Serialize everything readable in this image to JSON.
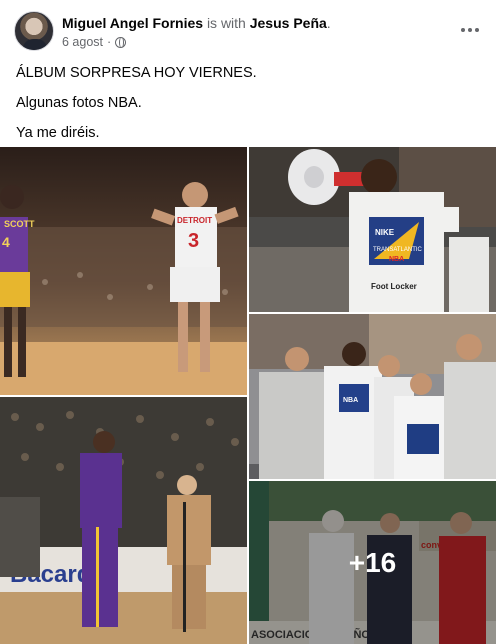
{
  "post": {
    "author": "Miguel Angel Fornies",
    "with_text": "is with",
    "tagged": "Jesus Peña",
    "tagged_suffix": ".",
    "date": "6 agost",
    "date_separator": "·",
    "privacy_icon": "globe-icon",
    "menu_icon": "more-dots-icon",
    "lines": [
      "ÁLBUM SORPRESA HOY VIERNES.",
      "Algunas fotos NBA.",
      "Ya me diréis."
    ]
  },
  "photos": {
    "tile1_jersey_left": "SCOTT",
    "tile1_number_left": "4",
    "tile1_jersey_main": "DETROIT",
    "tile1_number_main": "3",
    "tile2_shirt_brand": "NIKE",
    "tile2_shirt_line1": "TRANSATLANTIC",
    "tile2_shirt_line2": "NBA",
    "tile2_shirt_sponsor": "Foot Locker",
    "tile3_shirt_label": "NBA",
    "tile4_banner": "Bacardi",
    "tile5_wall_text": "ASOCIACION ESPAÑOLA",
    "tile5_corner_text": "conve",
    "more_count": "+16"
  },
  "colors": {
    "text_primary": "#050505",
    "text_secondary": "#65676b",
    "overlay_text": "#ffffff"
  }
}
